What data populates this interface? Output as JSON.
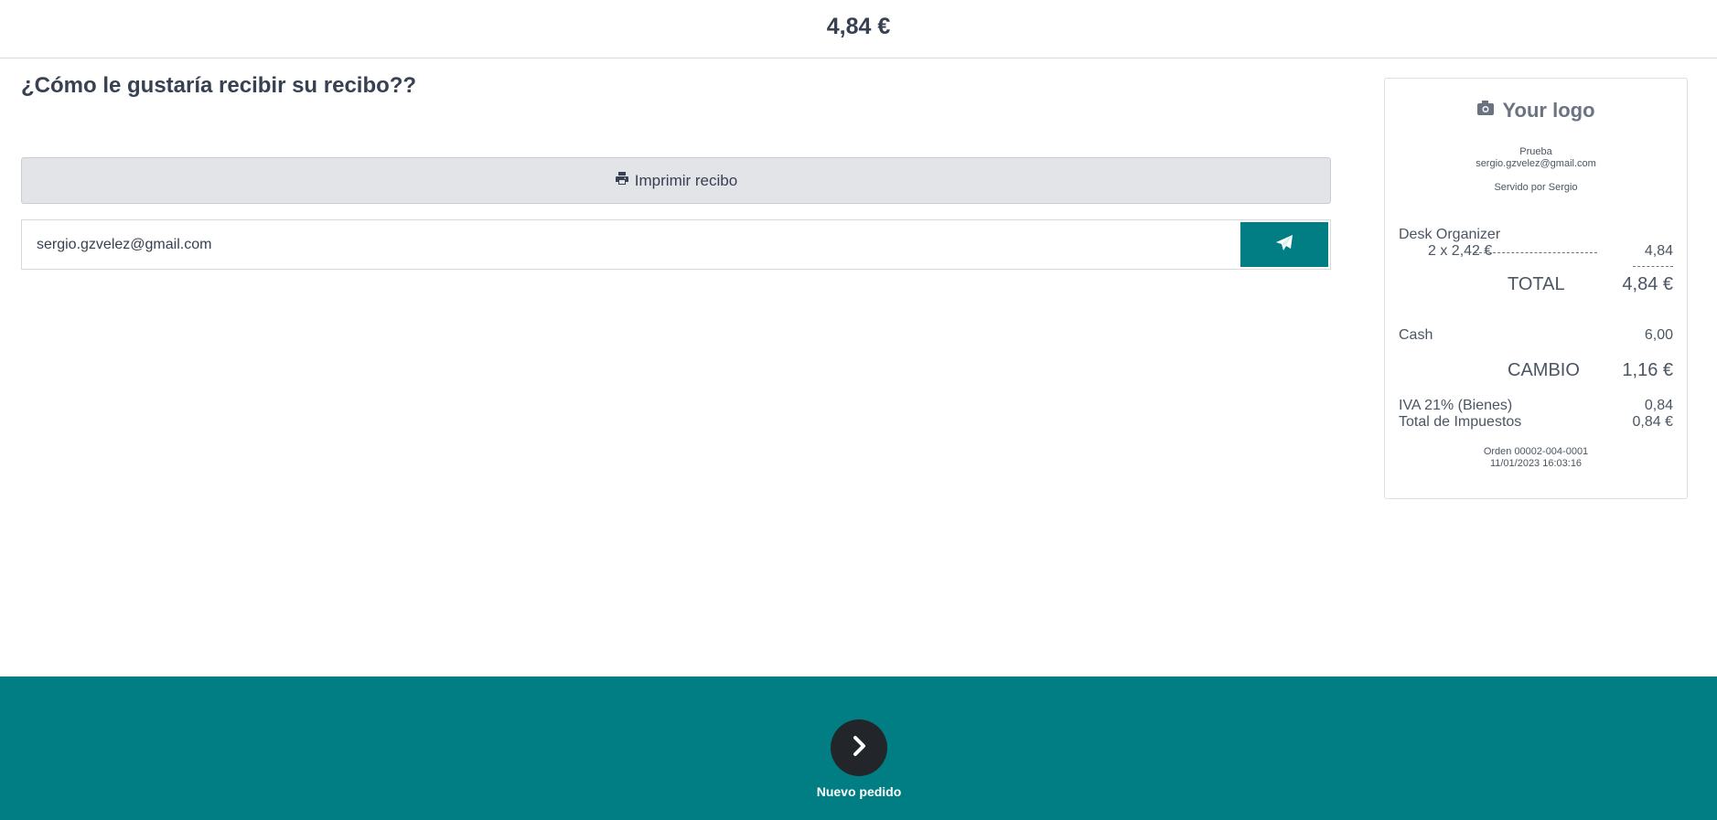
{
  "header": {
    "amount": "4,84 €"
  },
  "main": {
    "question": "¿Cómo le gustaría recibir su recibo??",
    "print_label": "Imprimir recibo",
    "email_value": "sergio.gzvelez@gmail.com"
  },
  "receipt": {
    "logo_text": "Your logo",
    "company": "Prueba",
    "company_email": "sergio.gzvelez@gmail.com",
    "served_by": "Servido por Sergio",
    "line": {
      "product": "Desk Organizer",
      "qty_price": "2 x 2,42 €",
      "amount": "4,84"
    },
    "total_label": "TOTAL",
    "total_value": "4,84 €",
    "payment": {
      "method": "Cash",
      "amount": "6,00"
    },
    "change_label": "CAMBIO",
    "change_value": "1,16 €",
    "tax": {
      "label": "IVA 21% (Bienes)",
      "amount": "0,84"
    },
    "tax_total": {
      "label": "Total de Impuestos",
      "amount": "0,84 €"
    },
    "order": "Orden 00002-004-0001",
    "datetime": "11/01/2023 16:03:16"
  },
  "footer": {
    "next_label": "Nuevo pedido"
  },
  "colors": {
    "accent": "#017e84",
    "dark_button": "#22262b"
  }
}
